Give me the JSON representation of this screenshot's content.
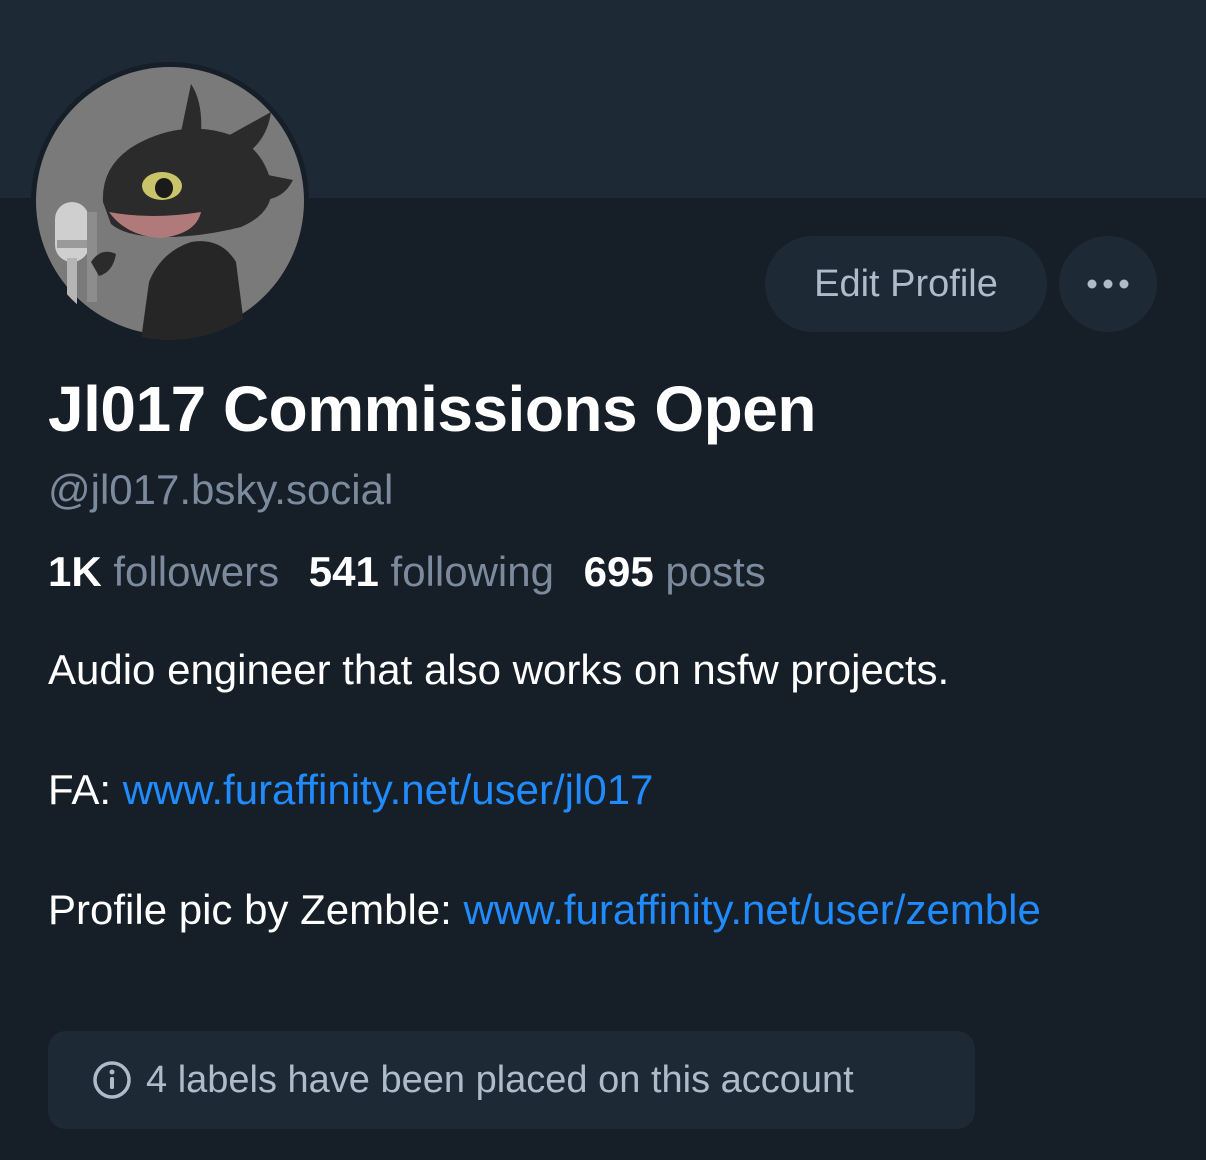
{
  "profile": {
    "display_name": "Jl017 Commissions Open",
    "handle": "@jl017.bsky.social",
    "avatar_icon": "dragon-avatar-icon"
  },
  "actions": {
    "edit_profile_label": "Edit Profile",
    "more_icon": "ellipsis-icon"
  },
  "stats": {
    "followers_count": "1K",
    "followers_label": "followers",
    "following_count": "541",
    "following_label": "following",
    "posts_count": "695",
    "posts_label": "posts"
  },
  "bio": {
    "line1": "Audio engineer that also works on nsfw projects.",
    "fa_prefix": "FA: ",
    "fa_link": "www.furaffinity.net/user/jl017",
    "pic_prefix": "Profile pic by Zemble: ",
    "pic_link": "www.furaffinity.net/user/zemble"
  },
  "labels_notice": {
    "text": "4 labels have been placed on this account",
    "icon": "info-icon"
  },
  "colors": {
    "background": "#161e27",
    "banner": "#1e2936",
    "link": "#208bfe",
    "muted_text": "#7b8a9d"
  }
}
